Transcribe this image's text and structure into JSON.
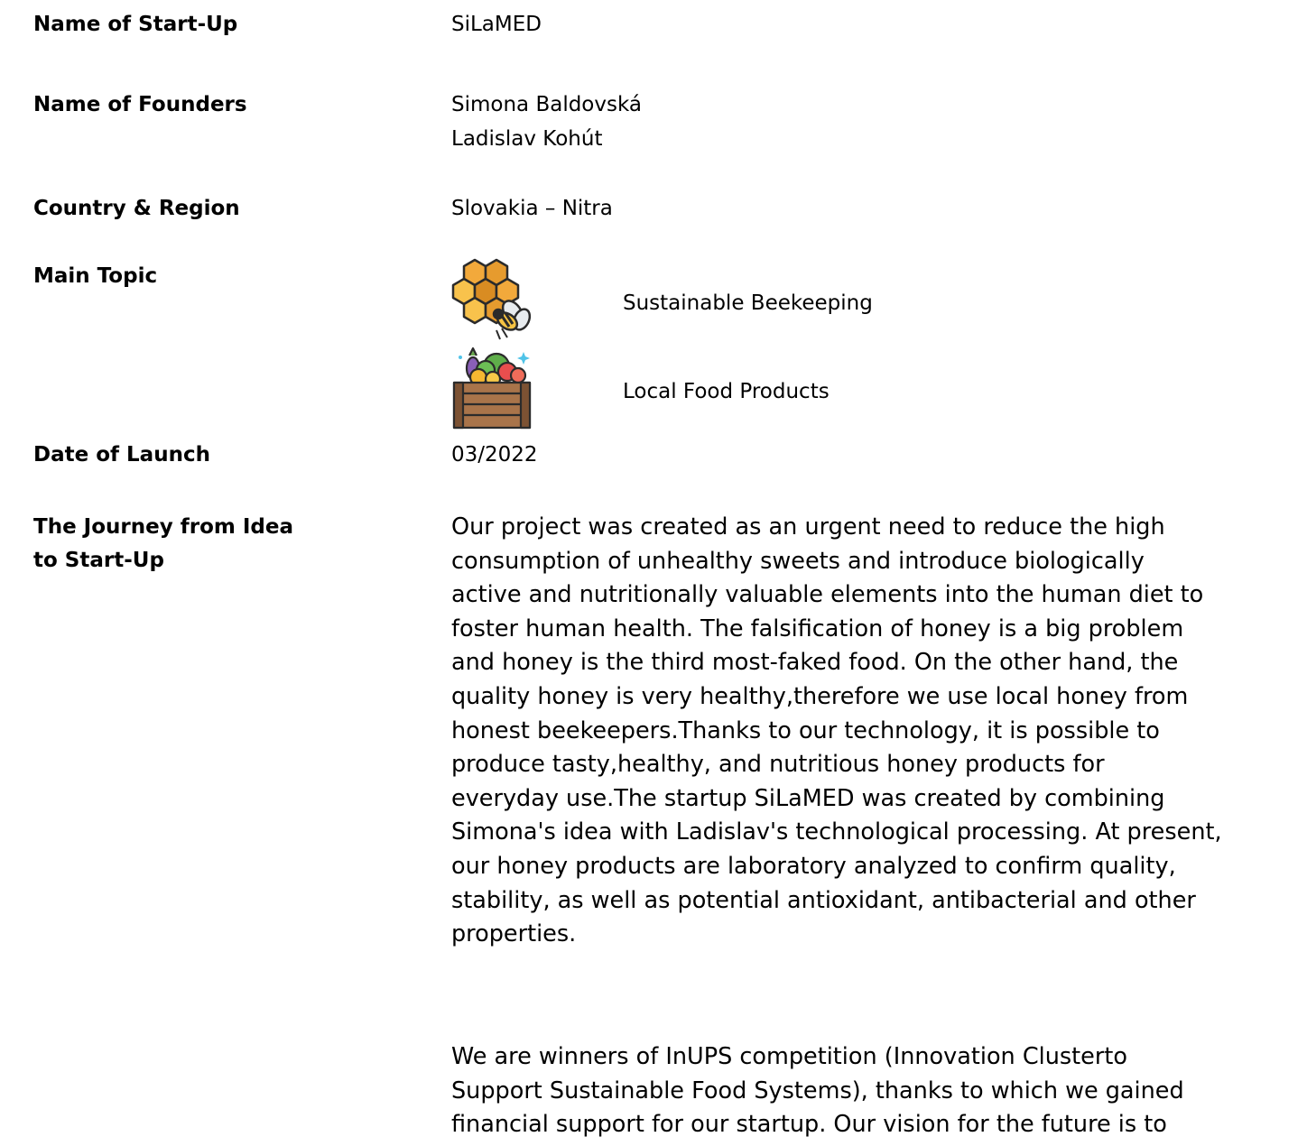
{
  "fields": {
    "startup_name": {
      "label": "Name of Start-Up",
      "value": "SiLaMED"
    },
    "founders": {
      "label": "Name of Founders",
      "values": [
        "Simona Baldovská",
        "Ladislav Kohút"
      ]
    },
    "country_region": {
      "label": "Country & Region",
      "value": "Slovakia – Nitra"
    },
    "main_topic": {
      "label": "Main Topic",
      "topics": [
        {
          "icon": "honeycomb-bee-icon",
          "label": "Sustainable Beekeeping"
        },
        {
          "icon": "produce-crate-icon",
          "label": "Local Food Products"
        }
      ]
    },
    "launch_date": {
      "label": "Date of Launch",
      "value": "03/2022"
    },
    "journey": {
      "label_lines": [
        "The Journey from Idea",
        "to Start-Up"
      ],
      "paragraph1_lines": [
        "Our project was created as an urgent need to reduce the high",
        "consumption of unhealthy sweets and introduce biologically",
        "active and nutritionally valuable elements into the human diet to",
        "foster human health. The falsification of honey is a big problem",
        "and honey is the third most-faked food. On the other hand, the",
        "quality honey is very healthy,therefore we use local honey from",
        "honest beekeepers.Thanks to our technology, it is possible to",
        "produce tasty,healthy, and nutritious honey products for",
        "everyday use.The startup SiLaMED was created by combining",
        "Simona's idea with Ladislav's technological processing. At present,",
        "our honey products are laboratory analyzed to confirm quality,",
        "stability, as well as potential antioxidant, antibacterial and other",
        "properties."
      ],
      "paragraph2_lines": [
        "We are winners of InUPS competition (Innovation Clusterto",
        "Support Sustainable Food Systems), thanks to which we gained",
        "financial support for our startup. Our vision for the future is to"
      ]
    }
  }
}
